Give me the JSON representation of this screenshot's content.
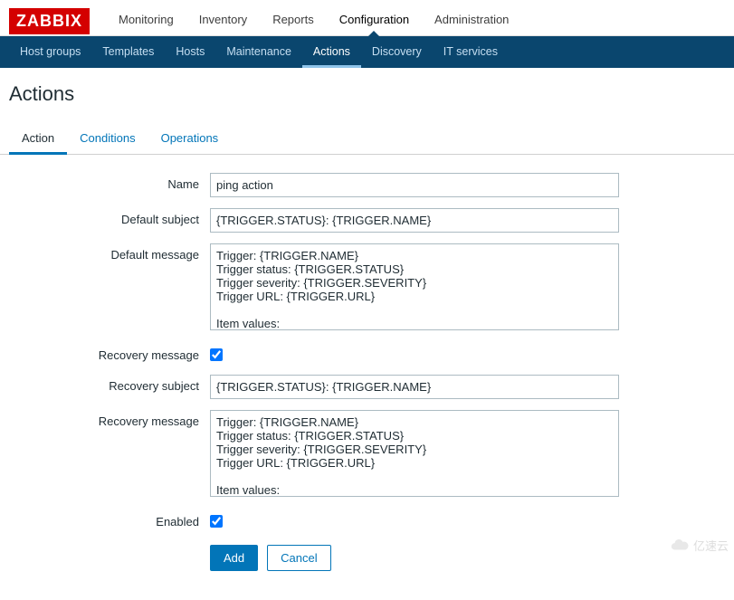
{
  "logo": "ZABBIX",
  "top_nav": {
    "items": [
      "Monitoring",
      "Inventory",
      "Reports",
      "Configuration",
      "Administration"
    ],
    "active_index": 3
  },
  "sub_nav": {
    "items": [
      "Host groups",
      "Templates",
      "Hosts",
      "Maintenance",
      "Actions",
      "Discovery",
      "IT services"
    ],
    "active_index": 4
  },
  "page_title": "Actions",
  "tabs": {
    "items": [
      "Action",
      "Conditions",
      "Operations"
    ],
    "active_index": 0
  },
  "form": {
    "name_label": "Name",
    "name_value": "ping action",
    "default_subject_label": "Default subject",
    "default_subject_value": "{TRIGGER.STATUS}: {TRIGGER.NAME}",
    "default_message_label": "Default message",
    "default_message_value": "Trigger: {TRIGGER.NAME}\nTrigger status: {TRIGGER.STATUS}\nTrigger severity: {TRIGGER.SEVERITY}\nTrigger URL: {TRIGGER.URL}\n\nItem values:\n",
    "recovery_checkbox_label": "Recovery message",
    "recovery_checkbox_checked": true,
    "recovery_subject_label": "Recovery subject",
    "recovery_subject_value": "{TRIGGER.STATUS}: {TRIGGER.NAME}",
    "recovery_message_label": "Recovery message",
    "recovery_message_value": "Trigger: {TRIGGER.NAME}\nTrigger status: {TRIGGER.STATUS}\nTrigger severity: {TRIGGER.SEVERITY}\nTrigger URL: {TRIGGER.URL}\n\nItem values:\n",
    "enabled_label": "Enabled",
    "enabled_checked": true,
    "add_button": "Add",
    "cancel_button": "Cancel"
  },
  "watermark": "亿速云"
}
